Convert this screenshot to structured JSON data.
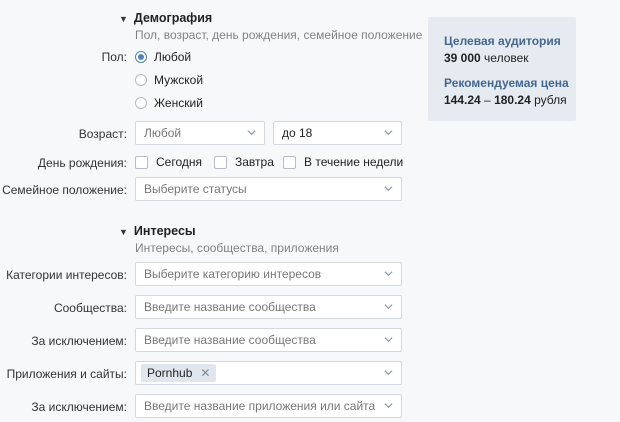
{
  "demography": {
    "title": "Демография",
    "subtitle": "Пол, возраст, день рождения, семейное положение",
    "gender_label": "Пол:",
    "gender_options": [
      "Любой",
      "Мужской",
      "Женский"
    ],
    "age_label": "Возраст:",
    "age_from": "Любой",
    "age_to": "до 18",
    "birthday_label": "День рождения:",
    "birthday_options": [
      "Сегодня",
      "Завтра",
      "В течение недели"
    ],
    "marital_label": "Семейное положение:",
    "marital_placeholder": "Выберите статусы"
  },
  "interests": {
    "title": "Интересы",
    "subtitle": "Интересы, сообщества, приложения",
    "categories_label": "Категории интересов:",
    "categories_placeholder": "Выберите категорию интересов",
    "communities_label": "Сообщества:",
    "communities_placeholder": "Введите название сообщества",
    "communities_exclude_label": "За исключением:",
    "communities_exclude_placeholder": "Введите название сообщества",
    "apps_label": "Приложения и сайты:",
    "apps_token": "Pornhub",
    "apps_exclude_label": "За исключением:",
    "apps_exclude_placeholder": "Введите название приложения или сайта"
  },
  "audience": {
    "title": "Целевая аудитория",
    "count": "39 000",
    "count_unit": "человек",
    "price_title": "Рекомендуемая цена",
    "price_min": "144.24",
    "price_dash": "–",
    "price_max": "180.24",
    "price_unit": "рубля"
  },
  "colors": {
    "accent": "#5181b8",
    "panel_bg": "#e5ebf1",
    "panel_title": "#45678f"
  }
}
